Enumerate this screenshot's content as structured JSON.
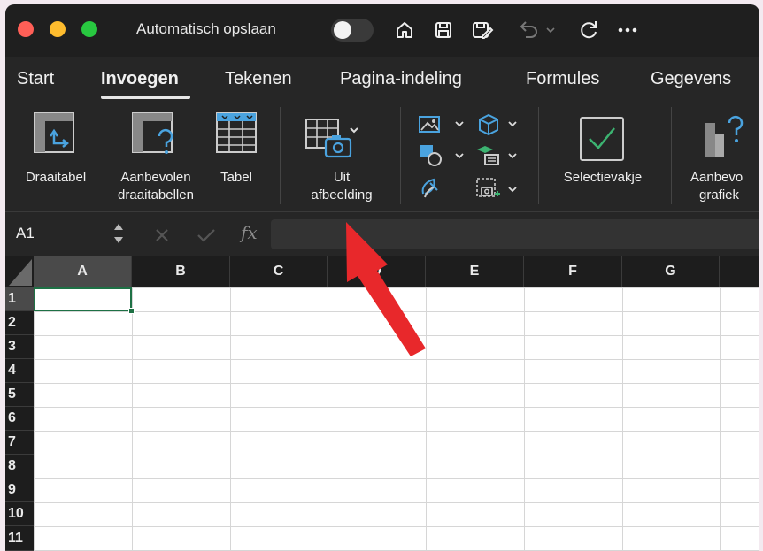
{
  "titlebar": {
    "title": "Automatisch opslaan",
    "autosave_on": false,
    "traffic_lights": [
      "#ff5f57",
      "#febc2e",
      "#28c840"
    ],
    "icons": [
      "home-icon",
      "save-icon",
      "save-as-icon",
      "undo-icon",
      "redo-icon",
      "more-icon"
    ]
  },
  "tabs": [
    {
      "label": "Start",
      "active": false
    },
    {
      "label": "Invoegen",
      "active": true
    },
    {
      "label": "Tekenen",
      "active": false
    },
    {
      "label": "Pagina-indeling",
      "active": false
    },
    {
      "label": "Formules",
      "active": false
    },
    {
      "label": "Gegevens",
      "active": false
    }
  ],
  "ribbon": {
    "pivot": "Draaitabel",
    "recommended_pivot_1": "Aanbevolen",
    "recommended_pivot_2": "draaitabellen",
    "table": "Tabel",
    "from_picture_1": "Uit",
    "from_picture_2": "afbeelding",
    "checkbox": "Selectievakje",
    "recommended_charts_1": "Aanbevo",
    "recommended_charts_2": "grafiek"
  },
  "formula_bar": {
    "name_box": "A1",
    "fx": "fx",
    "value": ""
  },
  "grid": {
    "columns": [
      "A",
      "B",
      "C",
      "D",
      "E",
      "F",
      "G"
    ],
    "rows": [
      "1",
      "2",
      "3",
      "4",
      "5",
      "6",
      "7",
      "8",
      "9",
      "10",
      "11"
    ],
    "active_cell": "A1"
  },
  "colors": {
    "chrome": "#262626",
    "accent_green": "#1e7145",
    "annotation_arrow": "#e8282b"
  }
}
